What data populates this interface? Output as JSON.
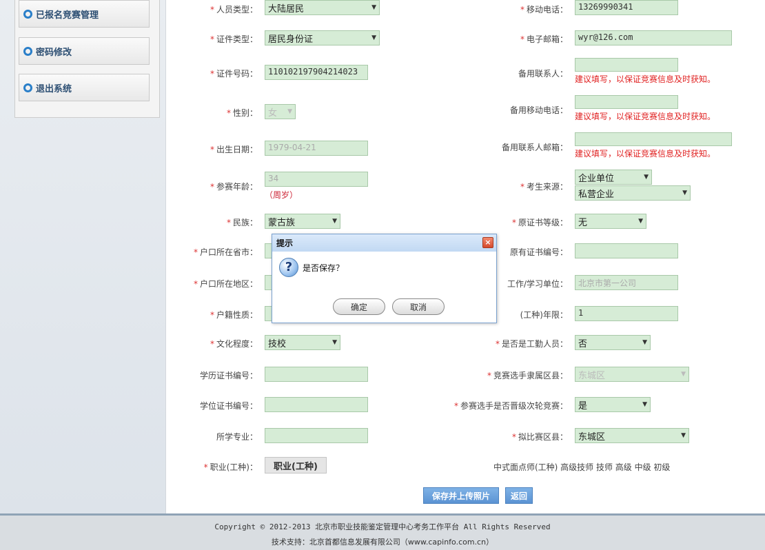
{
  "sidebar": {
    "items": [
      {
        "label": "已报名竞赛管理"
      },
      {
        "label": "密码修改"
      },
      {
        "label": "退出系统"
      }
    ]
  },
  "form": {
    "left": {
      "person_type": {
        "label": "人员类型：",
        "value": "大陆居民"
      },
      "id_type": {
        "label": "证件类型：",
        "value": "居民身份证"
      },
      "id_number": {
        "label": "证件号码：",
        "value": "110102197904214023"
      },
      "gender": {
        "label": "性别：",
        "value": "女"
      },
      "birth_date": {
        "label": "出生日期：",
        "value": "1979-04-21"
      },
      "age": {
        "label": "参赛年龄：",
        "value": "34",
        "unit": "（周岁）"
      },
      "ethnicity": {
        "label": "民族：",
        "value": "蒙古族"
      },
      "hukou_city": {
        "label": "户口所在省市："
      },
      "hukou_region": {
        "label": "户口所在地区："
      },
      "hukou_nature": {
        "label": "户籍性质："
      },
      "education": {
        "label": "文化程度：",
        "value": "技校"
      },
      "edu_cert_no": {
        "label": "学历证书编号：",
        "value": ""
      },
      "degree_cert_no": {
        "label": "学位证书编号：",
        "value": ""
      },
      "major": {
        "label": "所学专业：",
        "value": ""
      },
      "occupation": {
        "label": "职业(工种)：",
        "button": "职业(工种)"
      }
    },
    "right": {
      "mobile": {
        "label": "移动电话：",
        "value": "13269990341"
      },
      "email": {
        "label": "电子邮箱：",
        "value": "wyr@126.com"
      },
      "backup_contact": {
        "label": "备用联系人：",
        "hint": "建议填写，以保证竞赛信息及时获知。"
      },
      "backup_mobile": {
        "label": "备用移动电话：",
        "hint": "建议填写，以保证竞赛信息及时获知。"
      },
      "backup_email": {
        "label": "备用联系人邮箱：",
        "hint": "建议填写，以保证竞赛信息及时获知。"
      },
      "source": {
        "label": "考生来源：",
        "value1": "企业单位",
        "value2": "私营企业"
      },
      "orig_cert_level": {
        "label": "原证书等级：",
        "value": "无"
      },
      "orig_cert_no": {
        "label": "原有证书编号：",
        "value": ""
      },
      "work_unit": {
        "label": "工作/学习单位：",
        "value": "北京市第一公司"
      },
      "years": {
        "label": "(工种)年限：",
        "value": "1"
      },
      "is_worker": {
        "label": "是否是工勤人员：",
        "value": "否"
      },
      "district": {
        "label": "竞赛选手隶属区县：",
        "value": "东城区"
      },
      "promotion": {
        "label": "参赛选手是否晋级次轮竞赛：",
        "value": "是"
      },
      "competition_district": {
        "label": "拟比赛区县：",
        "value": "东城区"
      },
      "occupation_text": "中式面点师(工种)  高级技师  技师  高级  中级  初级"
    }
  },
  "actions": {
    "save_upload": "保存并上传照片",
    "back": "返回"
  },
  "dialog": {
    "title": "提示",
    "message": "是否保存？",
    "ok": "确定",
    "cancel": "取消",
    "close": "×"
  },
  "footer": {
    "copyright": "Copyright © 2012-2013 北京市职业技能鉴定管理中心考务工作平台 All Rights Reserved",
    "support": "技术支持：北京首都信息发展有限公司（www.capinfo.com.cn）"
  }
}
